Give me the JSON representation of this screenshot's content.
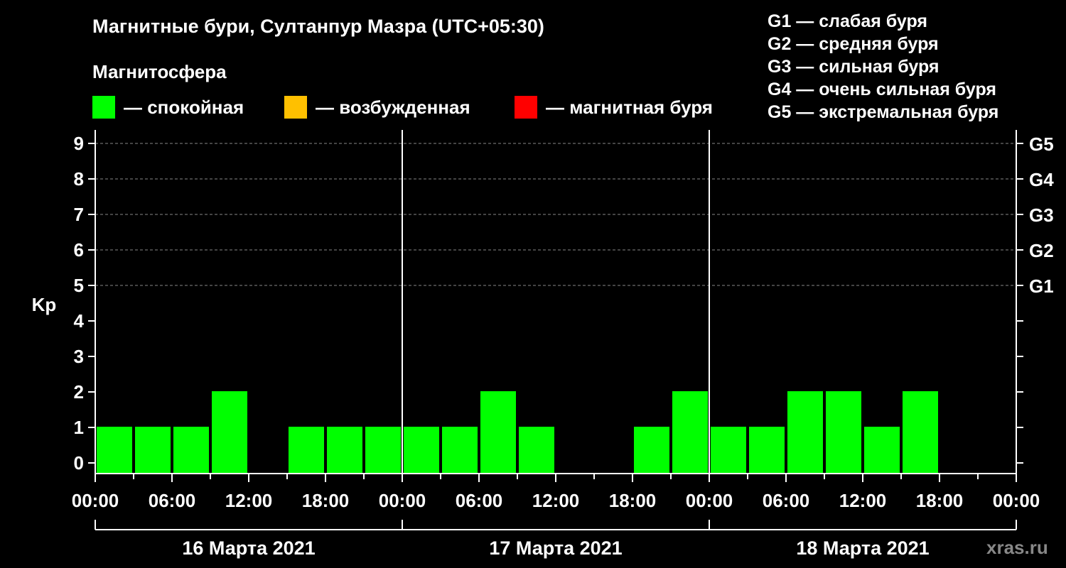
{
  "title": "Магнитные бури, Султанпур Мазра (UTC+05:30)",
  "subtitle": "Магнитосфера",
  "legend": [
    {
      "label": "— спокойная",
      "color": "#00ff00"
    },
    {
      "label": "— возбужденная",
      "color": "#ffc000"
    },
    {
      "label": "— магнитная буря",
      "color": "#ff0000"
    }
  ],
  "g_legend": [
    "G1 — слабая буря",
    "G2 — средняя буря",
    "G3 — сильная буря",
    "G4 — очень сильная буря",
    "G5 — экстремальная буря"
  ],
  "watermark": "xras.ru",
  "chart_data": {
    "type": "bar",
    "ylabel": "Kp",
    "ylim": [
      0,
      9
    ],
    "yticks": [
      "0",
      "1",
      "2",
      "3",
      "4",
      "5",
      "6",
      "7",
      "8",
      "9"
    ],
    "right_ticks": [
      {
        "value": 5,
        "label": "G1"
      },
      {
        "value": 6,
        "label": "G2"
      },
      {
        "value": 7,
        "label": "G3"
      },
      {
        "value": 8,
        "label": "G4"
      },
      {
        "value": 9,
        "label": "G5"
      }
    ],
    "xticks": [
      "00:00",
      "06:00",
      "12:00",
      "18:00",
      "00:00",
      "06:00",
      "12:00",
      "18:00",
      "00:00",
      "06:00",
      "12:00",
      "18:00",
      "00:00"
    ],
    "days": [
      "16 Марта 2021",
      "17 Марта 2021",
      "18 Марта 2021"
    ],
    "interval_hours": 3,
    "values": [
      1,
      1,
      1,
      2,
      0,
      1,
      1,
      1,
      1,
      1,
      2,
      1,
      0,
      0,
      1,
      2,
      1,
      1,
      2,
      2,
      1,
      2,
      null,
      null
    ],
    "bar_color": "#00ff00",
    "grid": true
  }
}
